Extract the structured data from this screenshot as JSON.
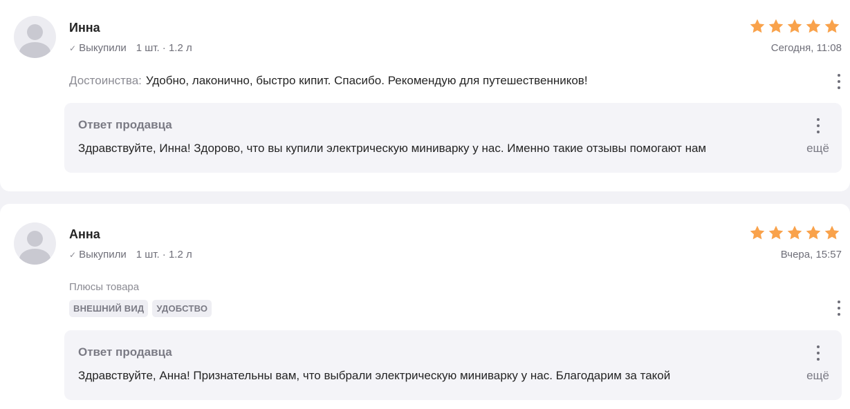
{
  "colors": {
    "star": "#f9a24b",
    "background": "#f2f2f6",
    "card": "#ffffff",
    "reply_bg": "#f4f4f8"
  },
  "reviews": [
    {
      "author": "Инна",
      "purchase_status": "Выкупили",
      "quantity_volume": "1 шт. · 1.2 л",
      "rating": 5,
      "date": "Сегодня, 11:08",
      "pros_label": "Достоинства:",
      "pros_text": "Удобно, лаконично, быстро кипит. Спасибо. Рекомендую для путешественников!",
      "reply": {
        "title": "Ответ продавца",
        "text": "Здравствуйте, Инна! Здорово, что вы купили электрическую миниварку у нас. Именно такие отзывы помогают нам",
        "more_label": "ещё"
      }
    },
    {
      "author": "Анна",
      "purchase_status": "Выкупили",
      "quantity_volume": "1 шт. · 1.2 л",
      "rating": 5,
      "date": "Вчера, 15:57",
      "pros_title": "Плюсы товара",
      "tags": [
        "ВНЕШНИЙ ВИД",
        "УДОБСТВО"
      ],
      "reply": {
        "title": "Ответ продавца",
        "text": "Здравствуйте, Анна! Признательны вам, что выбрали электрическую миниварку у нас. Благодарим за такой",
        "more_label": "ещё"
      }
    }
  ],
  "icons": {
    "verified": "checkmark-icon",
    "rating": "star-icon",
    "menu": "more-vertical-icon"
  }
}
